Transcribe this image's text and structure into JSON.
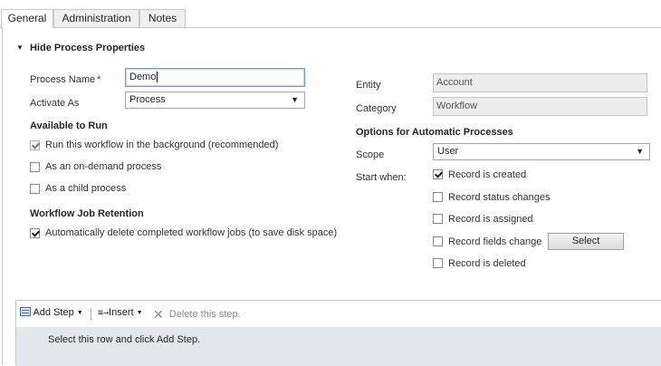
{
  "tabs": [
    {
      "label": "General"
    },
    {
      "label": "Administration"
    },
    {
      "label": "Notes"
    }
  ],
  "section": {
    "toggle_label": "Hide Process Properties"
  },
  "left": {
    "process_name_label": "Process Name",
    "required_mark": "*",
    "process_name_value": "Demo",
    "activate_as_label": "Activate As",
    "activate_as_value": "Process",
    "available_to_run_heading": "Available to Run",
    "run_background_label": "Run this workflow in the background (recommended)",
    "on_demand_label": "As an on-demand process",
    "child_process_label": "As a child process",
    "retention_heading": "Workflow Job Retention",
    "auto_delete_label": "Automatically delete completed workflow jobs (to save disk space)"
  },
  "right": {
    "entity_label": "Entity",
    "entity_value": "Account",
    "category_label": "Category",
    "category_value": "Workflow",
    "options_heading": "Options for Automatic Processes",
    "scope_label": "Scope",
    "scope_value": "User",
    "start_when_label": "Start when:",
    "record_created_label": "Record is created",
    "record_status_label": "Record status changes",
    "record_assigned_label": "Record is assigned",
    "record_fields_label": "Record fields change",
    "select_button_label": "Select",
    "record_deleted_label": "Record is deleted"
  },
  "toolbar": {
    "add_step_label": "Add Step",
    "insert_label": "Insert",
    "delete_label": "Delete this step."
  },
  "steps": {
    "placeholder_row": "Select this row and click Add Step."
  },
  "checkbox_states": {
    "run_background": true,
    "on_demand": false,
    "child_process": false,
    "auto_delete": true,
    "record_created": true,
    "record_status": false,
    "record_assigned": false,
    "record_fields": false,
    "record_deleted": false
  },
  "icons": {
    "toggle": "collapse-triangle-icon",
    "add_step": "add-step-icon",
    "insert": "insert-icon",
    "delete": "delete-x-icon"
  },
  "colors": {
    "required": "#cc0000",
    "focus_border": "#6e9fd0",
    "step_row_bg": "#e3e8ed"
  }
}
